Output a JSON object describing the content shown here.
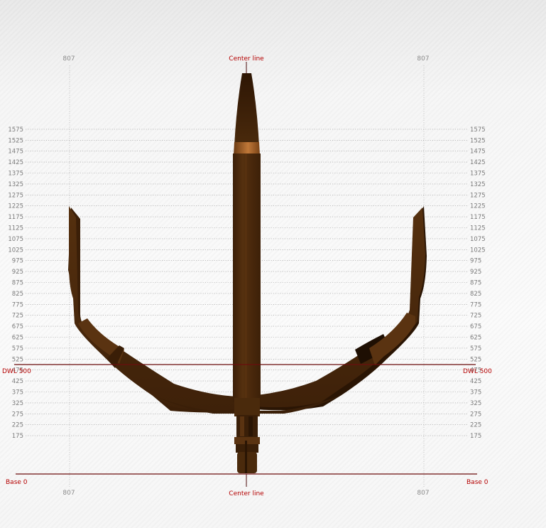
{
  "drawing": {
    "center_line_top": "Center line",
    "center_line_bottom": "Center line",
    "dwl_label_left": "DWL 500",
    "dwl_label_right": "DWL 500",
    "dwl_value": 500,
    "base_label_left": "Base 0",
    "base_label_right": "Base 0",
    "base_value": 0,
    "side_positions": {
      "left_top": "807",
      "right_top": "807",
      "left_bottom": "807",
      "right_bottom": "807"
    },
    "height_ticks": [
      1575,
      1525,
      1475,
      1425,
      1375,
      1325,
      1275,
      1225,
      1175,
      1125,
      1075,
      1025,
      975,
      925,
      875,
      825,
      775,
      725,
      675,
      625,
      575,
      525,
      475,
      425,
      375,
      325,
      275,
      225,
      175
    ],
    "colors": {
      "reference_line": "#6b0d0d",
      "reference_label": "#b40000",
      "frame_dark": "#3a1f08",
      "frame_mid": "#4e2c0e",
      "frame_light": "#6a3c14",
      "highlight": "#b36a2a"
    }
  }
}
